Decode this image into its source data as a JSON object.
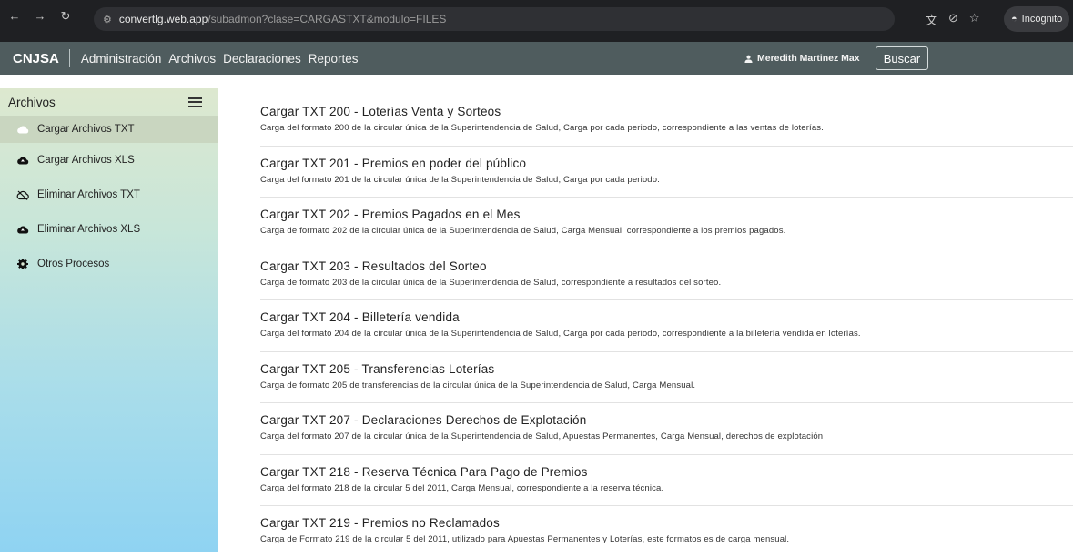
{
  "browser": {
    "url_host": "convertlg.web.app",
    "url_path": "/subadmon?clase=CARGASTXT&modulo=FILES",
    "incognito_label": "Incógnito"
  },
  "header": {
    "brand": "CNJSA",
    "menu": [
      "Administración",
      "Archivos",
      "Declaraciones",
      "Reportes"
    ],
    "user": "Meredith Martinez Max",
    "search_button": "Buscar"
  },
  "sidebar": {
    "title": "Archivos",
    "items": [
      {
        "label": "Cargar Archivos TXT",
        "icon": "cloud-icon"
      },
      {
        "label": "Cargar Archivos XLS",
        "icon": "cloud-upload-icon"
      },
      {
        "label": "Eliminar Archivos TXT",
        "icon": "cloud-off-icon"
      },
      {
        "label": "Eliminar Archivos XLS",
        "icon": "cloud-upload-icon"
      },
      {
        "label": "Otros Procesos",
        "icon": "gear-icon"
      }
    ]
  },
  "entries": [
    {
      "title": "Cargar TXT 200 - Loterías Venta y Sorteos",
      "desc": "Carga del formato 200 de la circular única de la Superintendencia de Salud, Carga por cada periodo, correspondiente a las ventas de loterías."
    },
    {
      "title": "Cargar TXT 201 - Premios en poder del público",
      "desc": "Carga del formato 201 de la circular única de la Superintendencia de Salud, Carga por cada periodo."
    },
    {
      "title": "Cargar TXT 202 - Premios Pagados en el Mes",
      "desc": "Carga de formato 202 de la circular única de la Superintendencia de Salud, Carga Mensual, correspondiente a los premios pagados."
    },
    {
      "title": "Cargar TXT 203 - Resultados del Sorteo",
      "desc": "Carga de formato 203 de la circular única de la Superintendencia de Salud, correspondiente a resultados del sorteo."
    },
    {
      "title": "Cargar TXT 204 - Billetería vendida",
      "desc": "Carga del formato 204 de la circular única de la Superintendencia de Salud, Carga por cada periodo, correspondiente a la billetería vendida en loterías."
    },
    {
      "title": "Cargar TXT 205 - Transferencias Loterías",
      "desc": "Carga de formato 205 de transferencias de la circular única de la Superintendencia de Salud, Carga Mensual."
    },
    {
      "title": "Cargar TXT 207 - Declaraciones Derechos de Explotación",
      "desc": "Carga del formato 207 de la circular única de la Superintendencia de Salud, Apuestas Permanentes, Carga Mensual, derechos de explotación"
    },
    {
      "title": "Cargar TXT 218 - Reserva Técnica Para Pago de Premios",
      "desc": "Carga del formato 218 de la circular 5 del 2011, Carga Mensual, correspondiente a la reserva técnica."
    },
    {
      "title": "Cargar TXT 219 - Premios no Reclamados",
      "desc": "Carga de Formato 219 de la circular 5 del 2011, utilizado para Apuestas Permanentes y Loterías, este formatos es de carga mensual."
    }
  ]
}
